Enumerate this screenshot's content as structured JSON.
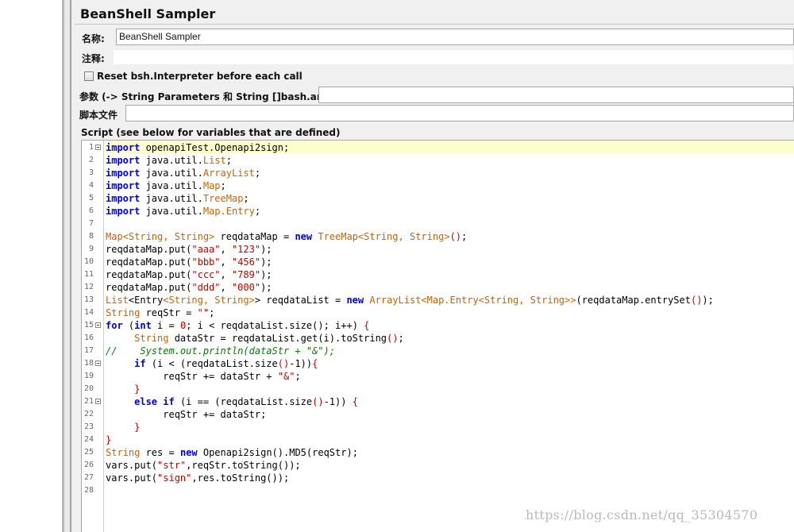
{
  "panel": {
    "title": "BeanShell Sampler",
    "name_label": "名称:",
    "name_value": "BeanShell Sampler",
    "comment_label": "注释:",
    "comment_value": "",
    "reset_label": "Reset bsh.Interpreter before each call",
    "params_label": "参数 (-> String Parameters 和 String []bash.args)",
    "params_value": "",
    "script_file_label": "脚本文件",
    "script_file_value": "",
    "script_label": "Script (see below for variables that are defined)"
  },
  "editor": {
    "lines": [
      {
        "n": "1",
        "fold": true,
        "tokens": [
          [
            "kw",
            "import"
          ],
          [
            "",
            " openapiTest.Openapi2sign;"
          ]
        ]
      },
      {
        "n": "2",
        "fold": false,
        "tokens": [
          [
            "kw",
            "import"
          ],
          [
            "",
            " java.util."
          ],
          [
            "ty",
            "List"
          ],
          [
            "",
            ";"
          ]
        ]
      },
      {
        "n": "3",
        "fold": false,
        "tokens": [
          [
            "kw",
            "import"
          ],
          [
            "",
            " java.util."
          ],
          [
            "ty",
            "ArrayList"
          ],
          [
            "",
            ";"
          ]
        ]
      },
      {
        "n": "4",
        "fold": false,
        "tokens": [
          [
            "kw",
            "import"
          ],
          [
            "",
            " java.util."
          ],
          [
            "ty",
            "Map"
          ],
          [
            "",
            ";"
          ]
        ]
      },
      {
        "n": "5",
        "fold": false,
        "tokens": [
          [
            "kw",
            "import"
          ],
          [
            "",
            " java.util."
          ],
          [
            "ty",
            "TreeMap"
          ],
          [
            "",
            ";"
          ]
        ]
      },
      {
        "n": "6",
        "fold": false,
        "tokens": [
          [
            "kw",
            "import"
          ],
          [
            "",
            " java.util."
          ],
          [
            "ty",
            "Map.Entry"
          ],
          [
            "",
            ";"
          ]
        ]
      },
      {
        "n": "7",
        "fold": false,
        "tokens": []
      },
      {
        "n": "8",
        "fold": false,
        "tokens": [
          [
            "ty",
            "Map<String, String>"
          ],
          [
            "",
            " reqdataMap = "
          ],
          [
            "kw",
            "new"
          ],
          [
            "",
            " "
          ],
          [
            "ty",
            "TreeMap<String, String>"
          ],
          [
            "st",
            "()"
          ],
          [
            "",
            ";"
          ]
        ]
      },
      {
        "n": "9",
        "fold": false,
        "tokens": [
          [
            "",
            "reqdataMap.put("
          ],
          [
            "st",
            "\"aaa\""
          ],
          [
            "",
            ", "
          ],
          [
            "st",
            "\"123\""
          ],
          [
            "",
            ");"
          ]
        ]
      },
      {
        "n": "10",
        "fold": false,
        "tokens": [
          [
            "",
            "reqdataMap.put("
          ],
          [
            "st",
            "\"bbb\""
          ],
          [
            "",
            ", "
          ],
          [
            "st",
            "\"456\""
          ],
          [
            "",
            ");"
          ]
        ]
      },
      {
        "n": "11",
        "fold": false,
        "tokens": [
          [
            "",
            "reqdataMap.put("
          ],
          [
            "st",
            "\"ccc\""
          ],
          [
            "",
            ", "
          ],
          [
            "st",
            "\"789\""
          ],
          [
            "",
            ");"
          ]
        ]
      },
      {
        "n": "12",
        "fold": false,
        "tokens": [
          [
            "",
            "reqdataMap.put("
          ],
          [
            "st",
            "\"ddd\""
          ],
          [
            "",
            ", "
          ],
          [
            "st",
            "\"000\""
          ],
          [
            "",
            ");"
          ]
        ]
      },
      {
        "n": "13",
        "fold": false,
        "tokens": [
          [
            "ty",
            "List"
          ],
          [
            "",
            "<Entry"
          ],
          [
            "ty",
            "<String, String>"
          ],
          [
            "",
            "> reqdataList = "
          ],
          [
            "kw",
            "new"
          ],
          [
            "",
            " "
          ],
          [
            "ty",
            "ArrayList<Map.Entry<String, String>>"
          ],
          [
            "",
            "(reqdataMap.entrySet"
          ],
          [
            "st",
            "()"
          ],
          [
            "",
            ");"
          ]
        ]
      },
      {
        "n": "14",
        "fold": false,
        "tokens": [
          [
            "ty",
            "String"
          ],
          [
            "",
            " reqStr = "
          ],
          [
            "st",
            "\"\""
          ],
          [
            "",
            ";"
          ]
        ]
      },
      {
        "n": "15",
        "fold": true,
        "tokens": [
          [
            "kw",
            "for"
          ],
          [
            "",
            " ("
          ],
          [
            "kw",
            "int"
          ],
          [
            "",
            " i = "
          ],
          [
            "nu",
            "0"
          ],
          [
            "",
            "; i < reqdataList.size(); i++) "
          ],
          [
            "st",
            "{"
          ]
        ]
      },
      {
        "n": "16",
        "fold": false,
        "tokens": [
          [
            "",
            "     "
          ],
          [
            "ty",
            "String"
          ],
          [
            "",
            " dataStr = reqdataList.get(i).toString"
          ],
          [
            "st",
            "()"
          ],
          [
            "",
            ";"
          ]
        ]
      },
      {
        "n": "17",
        "fold": false,
        "tokens": [
          [
            "cm",
            "//    System.out.println(dataStr + \"&\");"
          ]
        ]
      },
      {
        "n": "18",
        "fold": true,
        "tokens": [
          [
            "",
            "     "
          ],
          [
            "kw",
            "if"
          ],
          [
            "",
            " (i < (reqdataList.size"
          ],
          [
            "st",
            "()"
          ],
          [
            "",
            "-1))"
          ],
          [
            "st",
            "{"
          ]
        ]
      },
      {
        "n": "19",
        "fold": false,
        "tokens": [
          [
            "",
            "          reqStr += dataStr + "
          ],
          [
            "st",
            "\"&\""
          ],
          [
            "",
            ";"
          ]
        ]
      },
      {
        "n": "20",
        "fold": false,
        "tokens": [
          [
            "",
            "     "
          ],
          [
            "st",
            "}"
          ]
        ]
      },
      {
        "n": "21",
        "fold": true,
        "tokens": [
          [
            "",
            "     "
          ],
          [
            "kw",
            "else"
          ],
          [
            "",
            " "
          ],
          [
            "kw",
            "if"
          ],
          [
            "",
            " (i == (reqdataList.size"
          ],
          [
            "st",
            "()"
          ],
          [
            "",
            "-1)) "
          ],
          [
            "st",
            "{"
          ]
        ]
      },
      {
        "n": "22",
        "fold": false,
        "tokens": [
          [
            "",
            "          reqStr += dataStr;"
          ]
        ]
      },
      {
        "n": "23",
        "fold": false,
        "tokens": [
          [
            "",
            "     "
          ],
          [
            "st",
            "}"
          ]
        ]
      },
      {
        "n": "24",
        "fold": false,
        "tokens": [
          [
            "st",
            "}"
          ]
        ]
      },
      {
        "n": "25",
        "fold": false,
        "tokens": [
          [
            "ty",
            "String"
          ],
          [
            "",
            " res = "
          ],
          [
            "kw",
            "new"
          ],
          [
            "",
            " Openapi2sign().MD5(reqStr);"
          ]
        ]
      },
      {
        "n": "26",
        "fold": false,
        "tokens": [
          [
            "",
            "vars.put("
          ],
          [
            "st",
            "\"str\""
          ],
          [
            "",
            ",reqStr.toString());"
          ]
        ]
      },
      {
        "n": "27",
        "fold": false,
        "tokens": [
          [
            "",
            "vars.put("
          ],
          [
            "st",
            "\"sign\""
          ],
          [
            "",
            ",res.toString());"
          ]
        ]
      },
      {
        "n": "28",
        "fold": false,
        "tokens": []
      }
    ]
  },
  "watermark": "https://blog.csdn.net/qq_35304570",
  "colors": {
    "keyword": "#0000e6",
    "type": "#c86400",
    "string": "#c80000",
    "comment": "#008000",
    "current_line": "#ffffcc"
  }
}
